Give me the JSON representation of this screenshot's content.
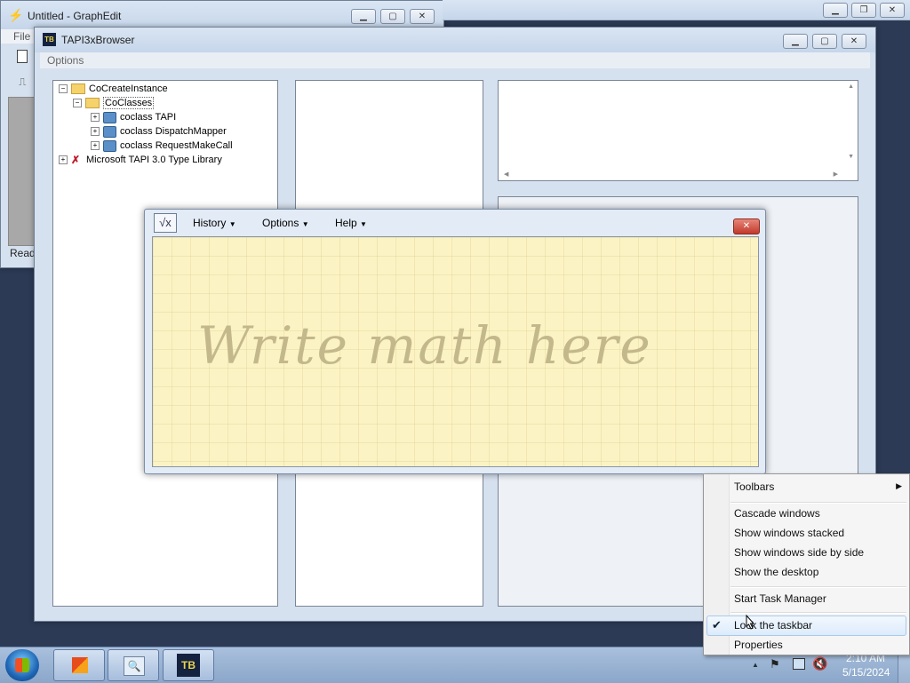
{
  "graphedit": {
    "title": "Untitled - GraphEdit",
    "menu_file": "File",
    "status": "Read"
  },
  "tapi": {
    "title": "TAPI3xBrowser",
    "menu_options": "Options",
    "tree": {
      "root": "CoCreateInstance",
      "coclasses": "CoClasses",
      "items": [
        "coclass TAPI",
        "coclass DispatchMapper",
        "coclass RequestMakeCall"
      ],
      "library": "Microsoft TAPI 3.0 Type Library"
    }
  },
  "math_panel": {
    "menu": {
      "history": "History",
      "options": "Options",
      "help": "Help"
    },
    "placeholder": "Write math here"
  },
  "context_menu": {
    "toolbars": "Toolbars",
    "cascade": "Cascade windows",
    "stacked": "Show windows stacked",
    "side_by_side": "Show windows side by side",
    "desktop": "Show the desktop",
    "task_manager": "Start Task Manager",
    "lock": "Lock the taskbar",
    "lock_checked": true,
    "properties": "Properties"
  },
  "taskbar": {
    "time": "2:10 AM",
    "date": "5/15/2024"
  },
  "icons": [
    "windows-start-icon",
    "office-icon",
    "graphedit-icon",
    "tapi-browser-icon",
    "flag-icon",
    "network-icon",
    "volume-muted-icon"
  ],
  "colors": {
    "desktop": "#2c3a55",
    "math_pad": "#fbf3c4",
    "menu_bg": "#f5f5f5",
    "close_red": "#c9473a"
  }
}
